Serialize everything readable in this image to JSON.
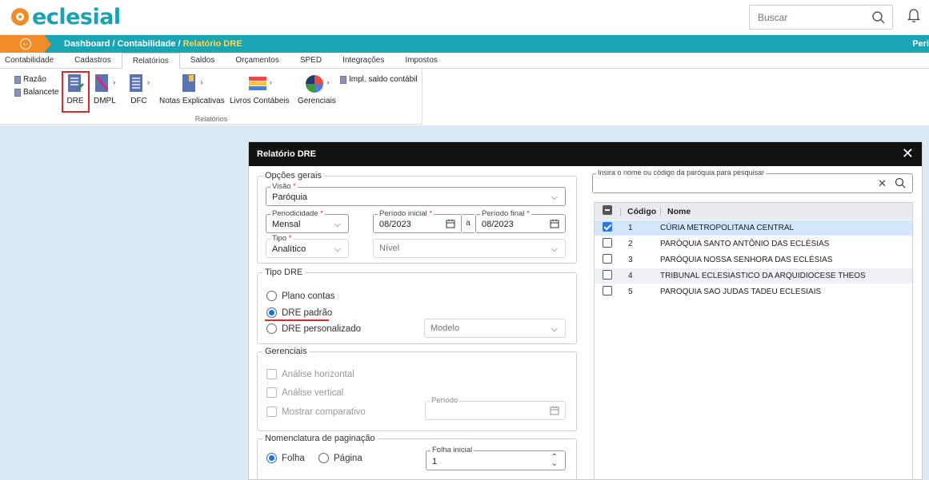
{
  "header": {
    "logo_text": "eclesial",
    "search_placeholder": "Buscar"
  },
  "breadcrumb": {
    "items": [
      "Dashboard",
      "Contabilidade",
      "Relatório DRE"
    ],
    "separator": "/",
    "right_text": "Peri"
  },
  "tabs": [
    "Contabilidade",
    "Cadastros",
    "Relatórios",
    "Saldos",
    "Orçamentos",
    "SPED",
    "Integrações",
    "Impostos"
  ],
  "active_tab": "Relatórios",
  "ribbon": {
    "small_items": [
      "Razão",
      "Balancete"
    ],
    "buttons": [
      "DRE",
      "DMPL",
      "DFC",
      "Notas Explicativas",
      "Livros Contábeis",
      "Gerenciais"
    ],
    "impl_label": "Impl. saldo contábil",
    "caption": "Relatórios"
  },
  "dialog": {
    "title": "Relatório DRE",
    "close_glyph": "✕",
    "general": {
      "legend": "Opções gerais",
      "visao_label": "Visão",
      "visao_value": "Paróquia",
      "periodicidade_label": "Periodicidade",
      "periodicidade_value": "Mensal",
      "periodo_inicial_label": "Período inicial",
      "periodo_inicial_value": "08/2023",
      "range_sep": "a",
      "periodo_final_label": "Período final",
      "periodo_final_value": "08/2023",
      "tipo_label": "Tipo",
      "tipo_value": "Analítico",
      "nivel_placeholder": "Nível",
      "required_mark": "*"
    },
    "tipo_dre": {
      "legend": "Tipo DRE",
      "options": [
        "Plano contas",
        "DRE padrão",
        "DRE personalizado"
      ],
      "selected": "DRE padrão",
      "modelo_placeholder": "Modelo"
    },
    "gerenciais": {
      "legend": "Gerenciais",
      "options": [
        "Análise horizontal",
        "Análise vertical",
        "Mostrar comparativo"
      ],
      "periodo_label": "Período"
    },
    "paginacao": {
      "legend": "Nomenclatura de paginação",
      "options": [
        "Folha",
        "Página"
      ],
      "selected": "Folha",
      "folha_inicial_label": "Folha inicial",
      "folha_inicial_value": "1"
    },
    "parish": {
      "search_label": "Insira o nome ou código da paróquia para pesquisar",
      "headers": {
        "code": "Código",
        "name": "Nome"
      },
      "rows": [
        {
          "code": "1",
          "name": "CÚRIA METROPOLITANA CENTRAL",
          "checked": true
        },
        {
          "code": "2",
          "name": "PARÓQUIA SANTO ANTÔNIO DAS ECLÉSIAS",
          "checked": false
        },
        {
          "code": "3",
          "name": "PARÓQUIA NOSSA SENHORA DAS ECLÉSIAS",
          "checked": false
        },
        {
          "code": "4",
          "name": "TRIBUNAL ECLESIASTICO DA ARQUIDIOCESE THEOS",
          "checked": false
        },
        {
          "code": "5",
          "name": "PAROQUIA SAO JUDAS TADEU ECLESIAIS",
          "checked": false
        }
      ]
    }
  },
  "colors": {
    "brand": "#17a2b8",
    "accent_orange": "#f28c28",
    "highlight_red": "#e0262b",
    "selected_blue": "#2b78e4"
  }
}
